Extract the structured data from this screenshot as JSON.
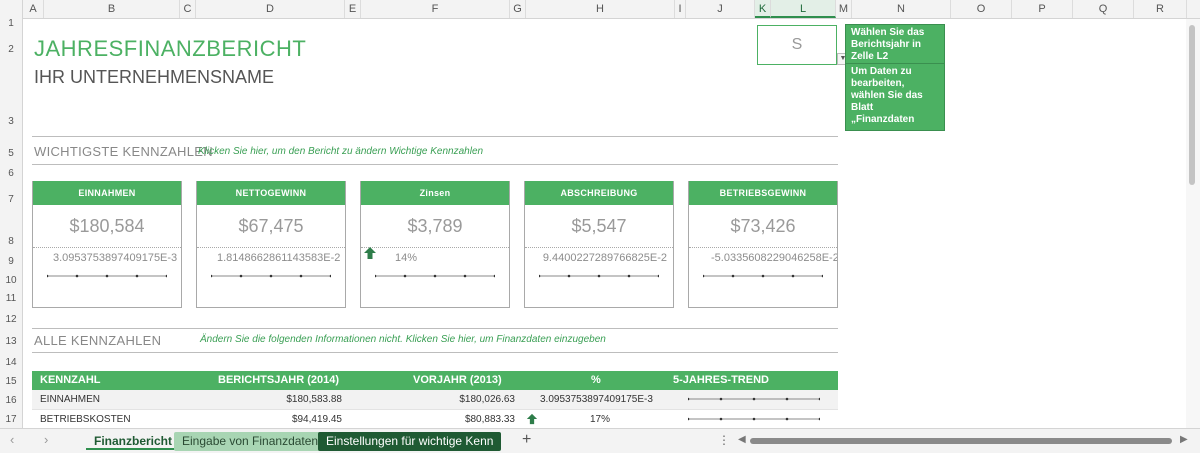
{
  "columns": [
    "A",
    "B",
    "C",
    "D",
    "E",
    "F",
    "G",
    "H",
    "I",
    "J",
    "K",
    "L",
    "M",
    "N",
    "O",
    "P",
    "Q",
    "R"
  ],
  "rows": [
    "1",
    "2",
    "3",
    "5",
    "6",
    "7",
    "8",
    "9",
    "10",
    "11",
    "12",
    "13",
    "14",
    "15",
    "16",
    "17"
  ],
  "report": {
    "title": "JAHRESFINANZBERICHT",
    "company": "IHR UNTERNEHMENSNAME",
    "year_cell": "S",
    "tip_year": "Wählen Sie das Berichtsjahr in Zelle L2",
    "tip_edit": "Um Daten zu bearbeiten, wählen Sie das Blatt „Finanzdaten"
  },
  "kpi_section": {
    "heading": "WICHTIGSTE KENNZAHLEN",
    "hint": "Klicken Sie hier, um den Bericht zu ändern Wichtige Kennzahlen"
  },
  "cards": [
    {
      "label": "EINNAHMEN",
      "value": "$180,584",
      "pct": "3.0953753897409175E-3",
      "arrow": false
    },
    {
      "label": "NETTOGEWINN",
      "value": "$67,475",
      "pct": "1.8148662861143583E-2",
      "arrow": false
    },
    {
      "label": "Zinsen",
      "value": "$3,789",
      "pct": "14%",
      "arrow": true
    },
    {
      "label": "ABSCHREIBUNG",
      "value": "$5,547",
      "pct": "9.4400227289766825E-2",
      "arrow": false
    },
    {
      "label": "BETRIEBSGEWINN",
      "value": "$73,426",
      "pct": "-5.0335608229046258E-2",
      "arrow": false
    }
  ],
  "all_section": {
    "heading": "ALLE KENNZAHLEN",
    "hint": "Ändern Sie die folgenden Informationen nicht. Klicken Sie hier, um Finanzdaten einzugeben"
  },
  "table": {
    "headers": [
      "KENNZAHL",
      "BERICHTSJAHR (2014)",
      "VORJAHR (2013)",
      "%",
      "5-JAHRES-TREND"
    ],
    "rows": [
      {
        "name": "EINNAHMEN",
        "current": "$180,583.88",
        "prior": "$180,026.63",
        "pct": "3.0953753897409175E-3",
        "arrow": false
      },
      {
        "name": "BETRIEBSKOSTEN",
        "current": "$94,419.45",
        "prior": "$80,883.33",
        "pct": "17%",
        "arrow": true
      }
    ]
  },
  "tabs": [
    {
      "label": "Finanzbericht",
      "active": true
    },
    {
      "label": "Eingabe von Finanzdaten",
      "active": false
    },
    {
      "label": "Einstellungen für wichtige Kenn",
      "active": false
    }
  ],
  "colors": {
    "accent": "#4cb163",
    "dark_tab": "#1f5a33"
  }
}
